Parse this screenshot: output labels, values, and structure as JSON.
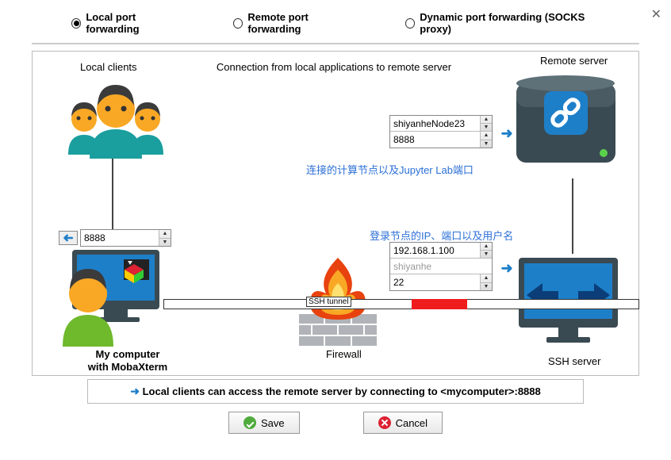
{
  "radios": {
    "local": "Local port forwarding",
    "remote": "Remote port forwarding",
    "dynamic": "Dynamic port forwarding (SOCKS proxy)"
  },
  "labels": {
    "local_clients": "Local clients",
    "remote_server": "Remote server",
    "connection": "Connection from local applications to remote server",
    "firewall": "Firewall",
    "ssh_tunnel": "SSH tunnel",
    "my_computer_l1": "My computer",
    "my_computer_l2": "with MobaXterm",
    "ssh_server": "SSH server"
  },
  "annotations": {
    "compute_node": "连接的计算节点以及Jupyter Lab端口",
    "login_node": "登录节点的IP、端口以及用户名"
  },
  "fields": {
    "local_port": "8888",
    "remote_host": "shiyanheNode23",
    "remote_port": "8888",
    "ssh_host": "192.168.1.100",
    "ssh_user_placeholder": "shiyanhe",
    "ssh_port": "22"
  },
  "footer": "Local clients can access the remote server by connecting to <mycomputer>:8888",
  "buttons": {
    "save": "Save",
    "cancel": "Cancel"
  }
}
